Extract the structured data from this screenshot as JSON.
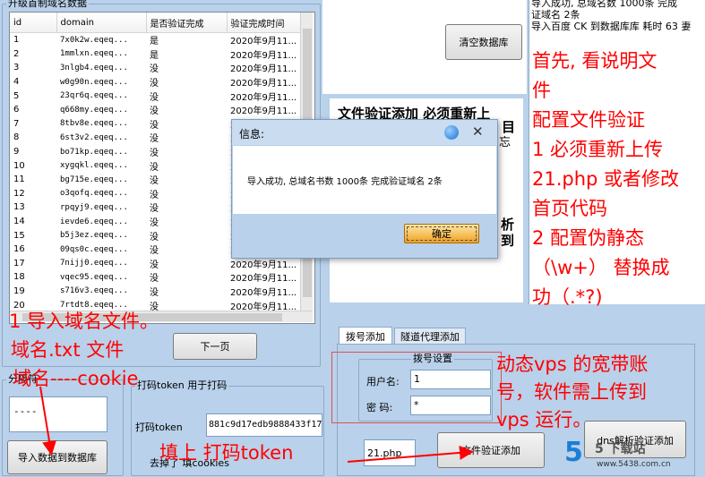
{
  "grid_group": {
    "title": "升级首制域名数据"
  },
  "grid": {
    "columns": [
      "id",
      "domain",
      "是否验证完成",
      "验证完成时间"
    ],
    "rows": [
      [
        "1",
        "7x0k2w.eqeq...",
        "是",
        "2020年9月11..."
      ],
      [
        "2",
        "1mmlxn.eqeq...",
        "是",
        "2020年9月11..."
      ],
      [
        "3",
        "3nlgb4.eqeq...",
        "没",
        "2020年9月11..."
      ],
      [
        "4",
        "w0g90n.eqeq...",
        "没",
        "2020年9月11..."
      ],
      [
        "5",
        "23qr6q.eqeq...",
        "没",
        "2020年9月11..."
      ],
      [
        "6",
        "q668my.eqeq...",
        "没",
        "2020年9月11..."
      ],
      [
        "7",
        "8tbv8e.eqeq...",
        "没",
        "2020年9月11..."
      ],
      [
        "8",
        "6st3v2.eqeq...",
        "没",
        "2020年9月11..."
      ],
      [
        "9",
        "bo71kp.eqeq...",
        "没",
        "2020年9月11..."
      ],
      [
        "10",
        "xygqkl.eqeq...",
        "没",
        "2020年9月11..."
      ],
      [
        "11",
        "bg715e.eqeq...",
        "没",
        "2020年9月11..."
      ],
      [
        "12",
        "o3qofq.eqeq...",
        "没",
        "2020年9月11..."
      ],
      [
        "13",
        "rpqyj9.eqeq...",
        "没",
        "2020年9月11..."
      ],
      [
        "14",
        "ievde6.eqeq...",
        "没",
        "2020年9月11..."
      ],
      [
        "15",
        "b5j3ez.eqeq...",
        "没",
        "2020年9月11..."
      ],
      [
        "16",
        "09qs0c.eqeq...",
        "没",
        "2020年9月11..."
      ],
      [
        "17",
        "7nijj0.eqeq...",
        "没",
        "2020年9月11..."
      ],
      [
        "18",
        "vqec95.eqeq...",
        "没",
        "2020年9月11..."
      ],
      [
        "19",
        "s716v3.eqeq...",
        "没",
        "2020年9月11..."
      ],
      [
        "20",
        "7rtdt8.eqeq...",
        "没",
        "2020年9月11..."
      ]
    ]
  },
  "buttons": {
    "next_page": "下一页",
    "import_db": "导入数据到数据库",
    "clear_db": "清空数据库",
    "file_verify_add": "文件验证添加",
    "dns_verify_add": "dns解析验证添加",
    "dialog_ok": "确定"
  },
  "separator_group": {
    "title": "分隔符",
    "value": "----"
  },
  "token_group": {
    "title": "打码token 用于打码",
    "label": "打码token",
    "value": "881c9d17edb9888433f17",
    "note": "去掉了 填cookies"
  },
  "tabs": [
    "拨号添加",
    "隧道代理添加"
  ],
  "dial_group": {
    "title": "拨号设置",
    "user_label": "用户名:",
    "user_value": "1",
    "pass_label": "密 码:",
    "pass_value": "*"
  },
  "file_field": {
    "value": "21.php"
  },
  "log": {
    "lines": [
      "导入成功, 总域名数 1000条 完成",
      "证域名 2条",
      "导入百度 CK 到数据库库 耗时 63 妻"
    ]
  },
  "bg_panel": {
    "line1": "文件验证添加 必须重新上",
    "line1_tail": "目",
    "partial1": "忘",
    "partial2": "析",
    "partial3": "到"
  },
  "dialog": {
    "title": "信息:",
    "message": "导入成功, 总域名书数 1000条 完成验证域名 2条"
  },
  "annotations": {
    "right": [
      "首先, 看说明文",
      "件",
      "配置文件验证",
      "1 必须重新上传",
      "21.php 或者修改",
      "首页代码",
      "2  配置伪静态",
      "（\\w+） 替换成",
      "功（.*?)"
    ],
    "import1": "1 导入域名文件。",
    "import2": "域名.txt  文件",
    "import3": "域名----cookie",
    "token": "填上 打码token",
    "vps": [
      "动态vps 的宽带账",
      "号，软件需上传到",
      "vps 运行。"
    ]
  },
  "watermark": {
    "brand": "5",
    "text": "5 下载站",
    "url": "www.5438.com.cn"
  },
  "colors": {
    "accent_red": "#ff0000",
    "window_bg": "#b9d1ea",
    "ok_orange": "#f0a020"
  }
}
